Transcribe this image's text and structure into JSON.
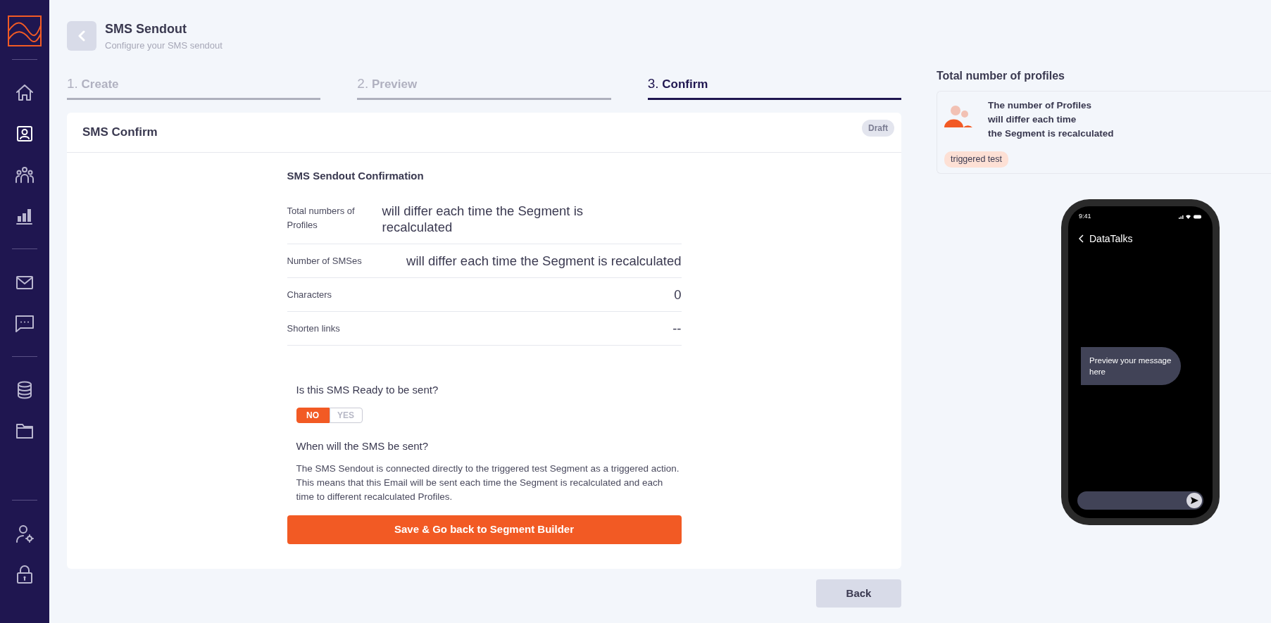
{
  "sidebar": {
    "groups": [
      {
        "items": [
          {
            "selected": false
          },
          {
            "selected": true
          },
          {
            "selected": false
          },
          {
            "selected": false
          }
        ]
      },
      {
        "items": [
          {
            "selected": false
          },
          {
            "selected": false
          }
        ]
      },
      {
        "items": [
          {
            "selected": false
          },
          {
            "selected": false
          }
        ]
      },
      {
        "items": [
          {
            "selected": false
          },
          {
            "selected": false
          }
        ]
      }
    ]
  },
  "header": {
    "title": "SMS Sendout",
    "subtitle": "Configure your SMS sendout"
  },
  "steps": [
    {
      "number": "1.",
      "label": "Create",
      "selected": false
    },
    {
      "number": "2.",
      "label": "Preview",
      "selected": false
    },
    {
      "number": "3.",
      "label": "Confirm",
      "selected": true
    }
  ],
  "card": {
    "title": "SMS Confirm",
    "badge": "Draft",
    "section_title": "SMS Sendout Confirmation",
    "rows": [
      {
        "label": "Total numbers of Profiles",
        "value": "will differ each time the Segment is recalculated"
      },
      {
        "label": "Number of SMSes",
        "value": "will differ each time the Segment is recalculated"
      },
      {
        "label": "Characters",
        "value": "0"
      },
      {
        "label": "Shorten links",
        "value": "--"
      }
    ],
    "ready_question": "Is this SMS Ready to be sent?",
    "toggle": [
      {
        "label": "NO",
        "selected": true
      },
      {
        "label": "YES",
        "selected": false
      }
    ],
    "when_title": "When will the SMS be sent?",
    "when_lines": [
      "The SMS Sendout is connected directly to the triggered test Segment as a triggered action.",
      "This means that this Email will be sent each time the Segment is recalculated and each time to different recalculated Profiles."
    ],
    "save_button": "Save & Go back to Segment Builder"
  },
  "back_button": "Back",
  "profiles": {
    "title": "Total number of profiles",
    "lines": [
      "The number of Profiles",
      "will differ each time",
      "the Segment is recalculated"
    ],
    "tag": "triggered test"
  },
  "phone": {
    "time": "9:41",
    "contact": "DataTalks",
    "message": "Preview your message here"
  }
}
